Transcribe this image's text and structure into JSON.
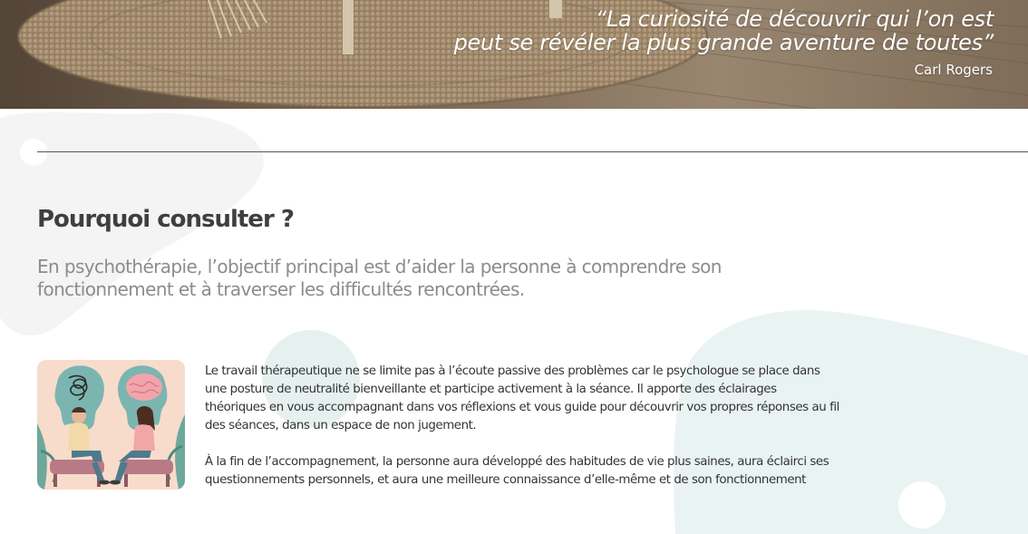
{
  "hero": {
    "quote_line_1": "“La curiosité de découvrir qui l’on est",
    "quote_line_2": "peut se révéler la plus grande aventure de toutes”",
    "author": "Carl Rogers"
  },
  "section": {
    "title": "Pourquoi consulter ?",
    "lead": "En psychothérapie, l’objectif principal est d’aider la personne à comprendre son fonctionnement et à traverser les difficultés rencontrées.",
    "paragraphs": [
      "Le travail thérapeutique ne se limite pas à l’écoute passive des problèmes car le psychologue se place dans une posture de neutralité bienveillante et participe activement à la séance. Il apporte des éclairages théoriques en vous accompagnant dans vos réflexions et vous guide pour découvrir vos propres réponses au fil des séances, dans un espace de non jugement.",
      "À la fin de l’accompagnement, la personne aura développé des habitudes de vie plus saines, aura éclairci ses questionnements personnels, et aura une meilleure connaissance d’elle-même et de son fonctionnement"
    ]
  },
  "colors": {
    "heading": "#3f3f3f",
    "lead": "#8c8c8c",
    "body": "#333333",
    "blob_gray": "#f3f3f3",
    "blob_teal": "#e8f2f1"
  },
  "icons": {
    "hero_image": "rug-on-wooden-floor-photo",
    "illustration": "therapy-session-illustration"
  }
}
